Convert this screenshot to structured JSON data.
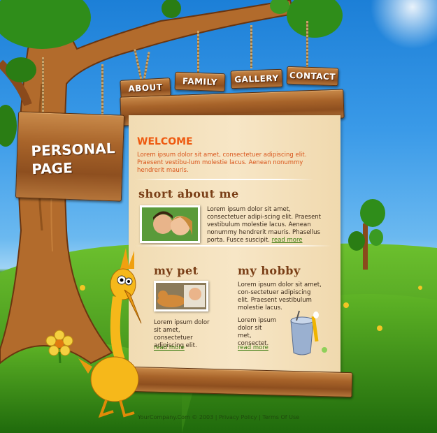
{
  "nav": {
    "items": [
      {
        "label": "ABOUT"
      },
      {
        "label": "FAMILY"
      },
      {
        "label": "GALLERY"
      },
      {
        "label": "CONTACT"
      }
    ]
  },
  "sign": {
    "line1": "PERSONAL",
    "line2": "PAGE"
  },
  "welcome": {
    "title": "WELCOME",
    "text": "Lorem ipsum dolor sit amet, consectetuer adipiscing elit. Praesent vestibu-lum molestie lacus. Aenean nonummy hendrerit mauris."
  },
  "about": {
    "title": "short about me",
    "text": "Lorem ipsum dolor sit amet, consectetuer adipi-scing elit. Praesent vestibulum molestie lacus. Aenean nonummy hendrerit mauris. Phasellus porta. Fusce suscipit.",
    "more": "read more"
  },
  "pet": {
    "title": "my pet",
    "text": "Lorem ipsum dolor sit amet, consectetuer adipiscing elit.",
    "more": "read more"
  },
  "hobby": {
    "title": "my hobby",
    "text1": "Lorem ipsum dolor sit amet, con-sectetuer adipiscing elit. Praesent vestibulum molestie lacus.",
    "text2": "Lorem ipsum dolor sit met, consectet.",
    "more": "read more"
  },
  "footer": {
    "copyright": "YourCompany.Com © 2003",
    "sep": "|",
    "privacy": "Privacy Policy",
    "terms": "Terms Of Use"
  },
  "icons": {
    "tree": "tree-icon",
    "bird": "bird-icon",
    "bucket": "bucket-icon",
    "flower": "flower-icon"
  },
  "colors": {
    "sky": "#3a9ae8",
    "grass": "#4a9a22",
    "wood": "#a8642a",
    "paper": "#f7e6c6",
    "accent": "#ee5a10",
    "link": "#3d7d12"
  }
}
